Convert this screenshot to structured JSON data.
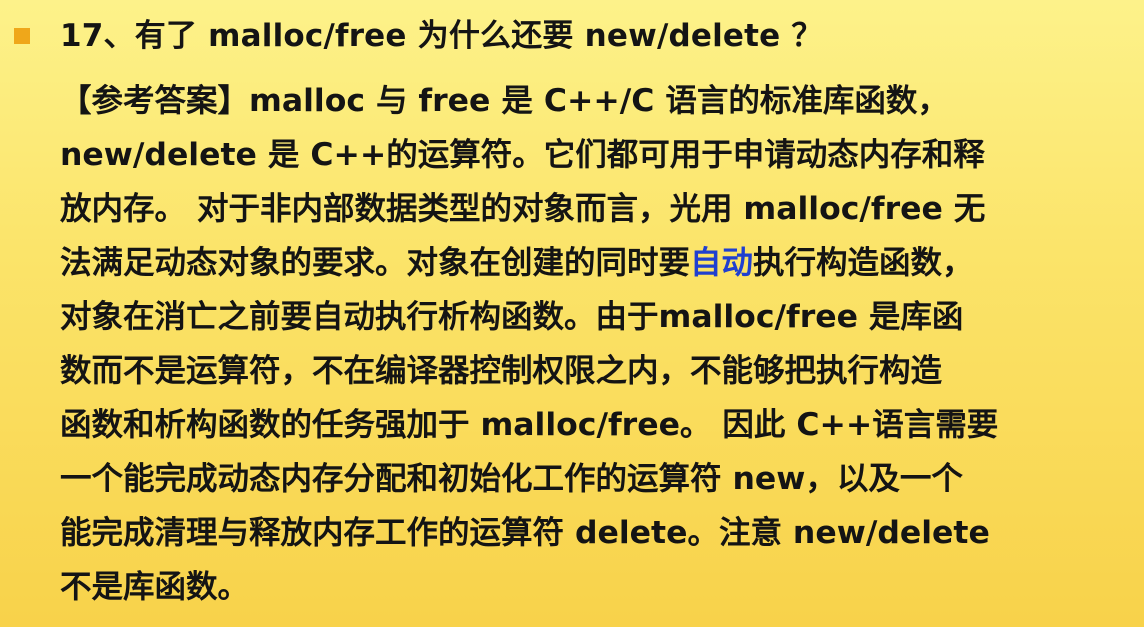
{
  "question": {
    "number": "17、",
    "text": "有了 malloc/free 为什么还要 new/delete ？"
  },
  "answer": {
    "label": "【参考答案】",
    "lines": [
      "malloc 与 free 是 C++/C 语言的标准库函数，",
      "new/delete 是 C++的运算符。它们都可用于申请动态内存和释",
      "放内存。 对于非内部数据类型的对象而言，光用 malloc/free 无",
      "法满足动态对象的要求。对象在创建的同时要",
      "对象在消亡之前要自动执行析构函数。由于malloc/free 是库函",
      "数而不是运算符，不在编译器控制权限之内，不能够把执行构造",
      "函数和析构函数的任务强加于 malloc/free。 因此 C++语言需要",
      "一个能完成动态内存分配和初始化工作的运算符 new，以及一个",
      "能完成清理与释放内存工作的运算符 delete。注意 new/delete",
      "不是库函数。"
    ],
    "line4_highlight": "自动",
    "line4_tail": "执行构造函数，"
  },
  "colors": {
    "background_top": "#fdf28a",
    "background_bottom": "#f8d24a",
    "bullet": "#efa71a",
    "highlight": "#1f3fd0",
    "text": "#141414"
  }
}
